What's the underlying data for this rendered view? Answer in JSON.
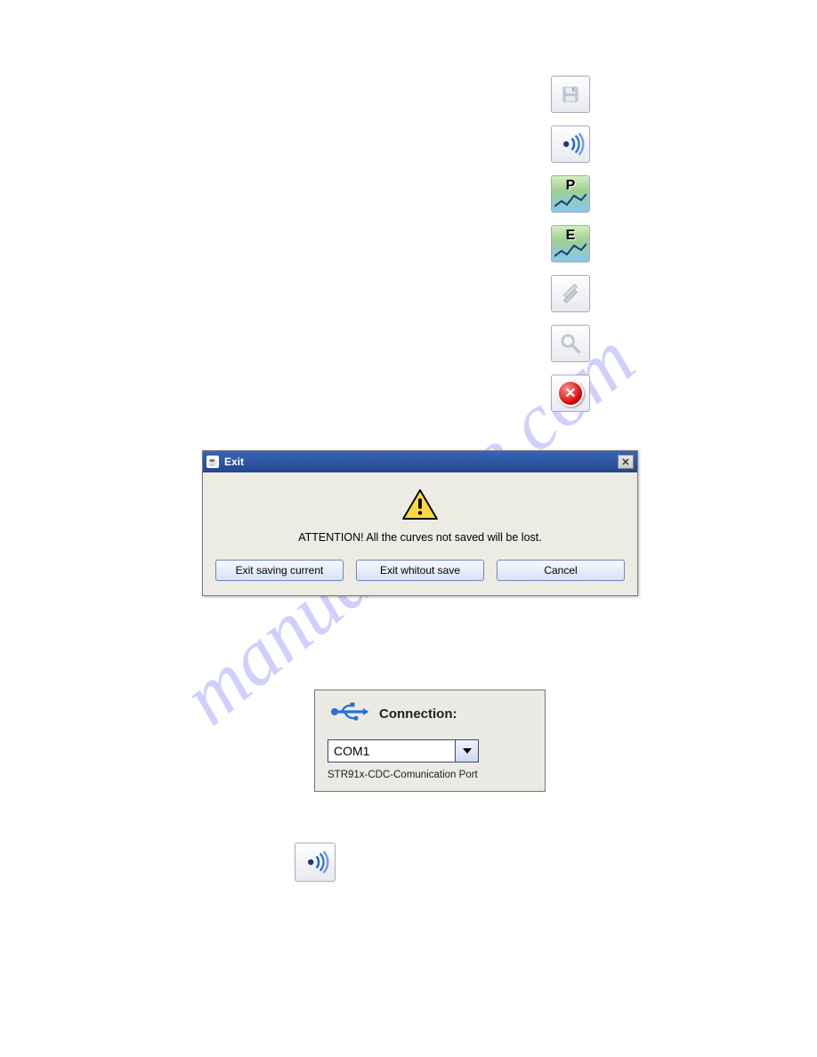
{
  "watermark": "manualshive.com",
  "toolbar": [
    {
      "name": "save-icon",
      "type": "save"
    },
    {
      "name": "broadcast-icon",
      "type": "broadcast"
    },
    {
      "name": "chart-p-icon",
      "type": "chart",
      "letter": "P"
    },
    {
      "name": "chart-e-icon",
      "type": "chart",
      "letter": "E"
    },
    {
      "name": "tools-icon",
      "type": "tools"
    },
    {
      "name": "search-icon",
      "type": "search"
    },
    {
      "name": "close-program-icon",
      "type": "close"
    }
  ],
  "dialog": {
    "title": "Exit",
    "message": "ATTENTION! All the curves not saved will be lost.",
    "buttons": {
      "save": "Exit saving current",
      "nosave": "Exit whitout save",
      "cancel": "Cancel"
    }
  },
  "connection": {
    "label": "Connection:",
    "selected": "COM1",
    "description": "STR91x-CDC-Comunication Port"
  }
}
